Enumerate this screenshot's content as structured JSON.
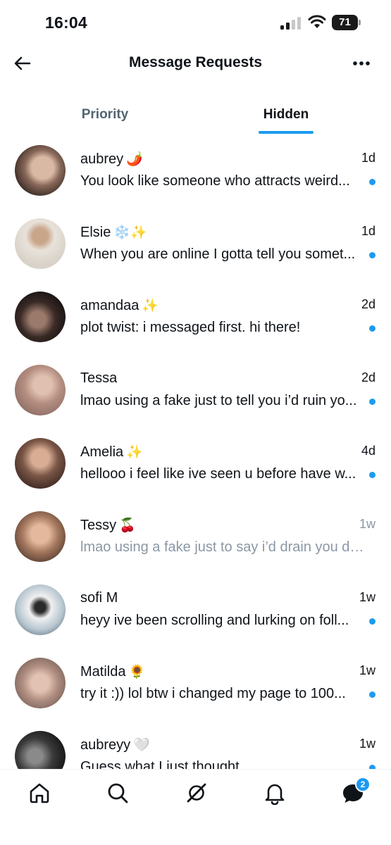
{
  "status_bar": {
    "time": "16:04",
    "battery": "71",
    "icons": [
      "cellular-signal-icon",
      "wifi-icon",
      "battery-icon"
    ]
  },
  "header": {
    "title": "Message Requests",
    "back_icon": "arrow-left-icon",
    "more_icon": "more-horizontal-icon"
  },
  "tabs": [
    {
      "label": "Priority",
      "selected": false
    },
    {
      "label": "Hidden",
      "selected": true
    }
  ],
  "conversations": [
    {
      "name": "aubrey",
      "emoji": "🌶️",
      "time": "1d",
      "preview": "You look like someone who attracts weird...",
      "unread": true
    },
    {
      "name": "Elsie",
      "emoji": "❄️✨",
      "time": "1d",
      "preview": "When you are online I gotta tell you somet...",
      "unread": true
    },
    {
      "name": "amandaa",
      "emoji": "✨",
      "time": "2d",
      "preview": "plot twist: i messaged first. hi there!",
      "unread": true
    },
    {
      "name": "Tessa",
      "emoji": "",
      "time": "2d",
      "preview": "lmao using a fake just to tell you i’d ruin yo...",
      "unread": true
    },
    {
      "name": "Amelia",
      "emoji": "✨",
      "time": "4d",
      "preview": "hellooo i feel like ive seen u before have w...",
      "unread": true
    },
    {
      "name": "Tessy",
      "emoji": "🍒",
      "time": "1w",
      "preview": "lmao using a fake just to say i’d drain you dr...",
      "unread": false
    },
    {
      "name": "sofi M",
      "emoji": "",
      "time": "1w",
      "preview": "heyy ive been scrolling and lurking on foll...",
      "unread": true
    },
    {
      "name": "Matilda",
      "emoji": "🌻",
      "time": "1w",
      "preview": "try it :)) lol btw i changed my page to  100...",
      "unread": true
    },
    {
      "name": "aubreyy",
      "emoji": "🤍",
      "time": "1w",
      "preview": "Guess what I just thought",
      "unread": true
    }
  ],
  "bottom_nav": {
    "items": [
      "home-icon",
      "search-icon",
      "grok-icon",
      "notifications-bell-icon",
      "messages-icon"
    ],
    "messages_badge": "2"
  },
  "colors": {
    "accent": "#1d9bf0",
    "text": "#0f1419",
    "secondary_text": "#536471",
    "read_text": "#8b98a5"
  }
}
